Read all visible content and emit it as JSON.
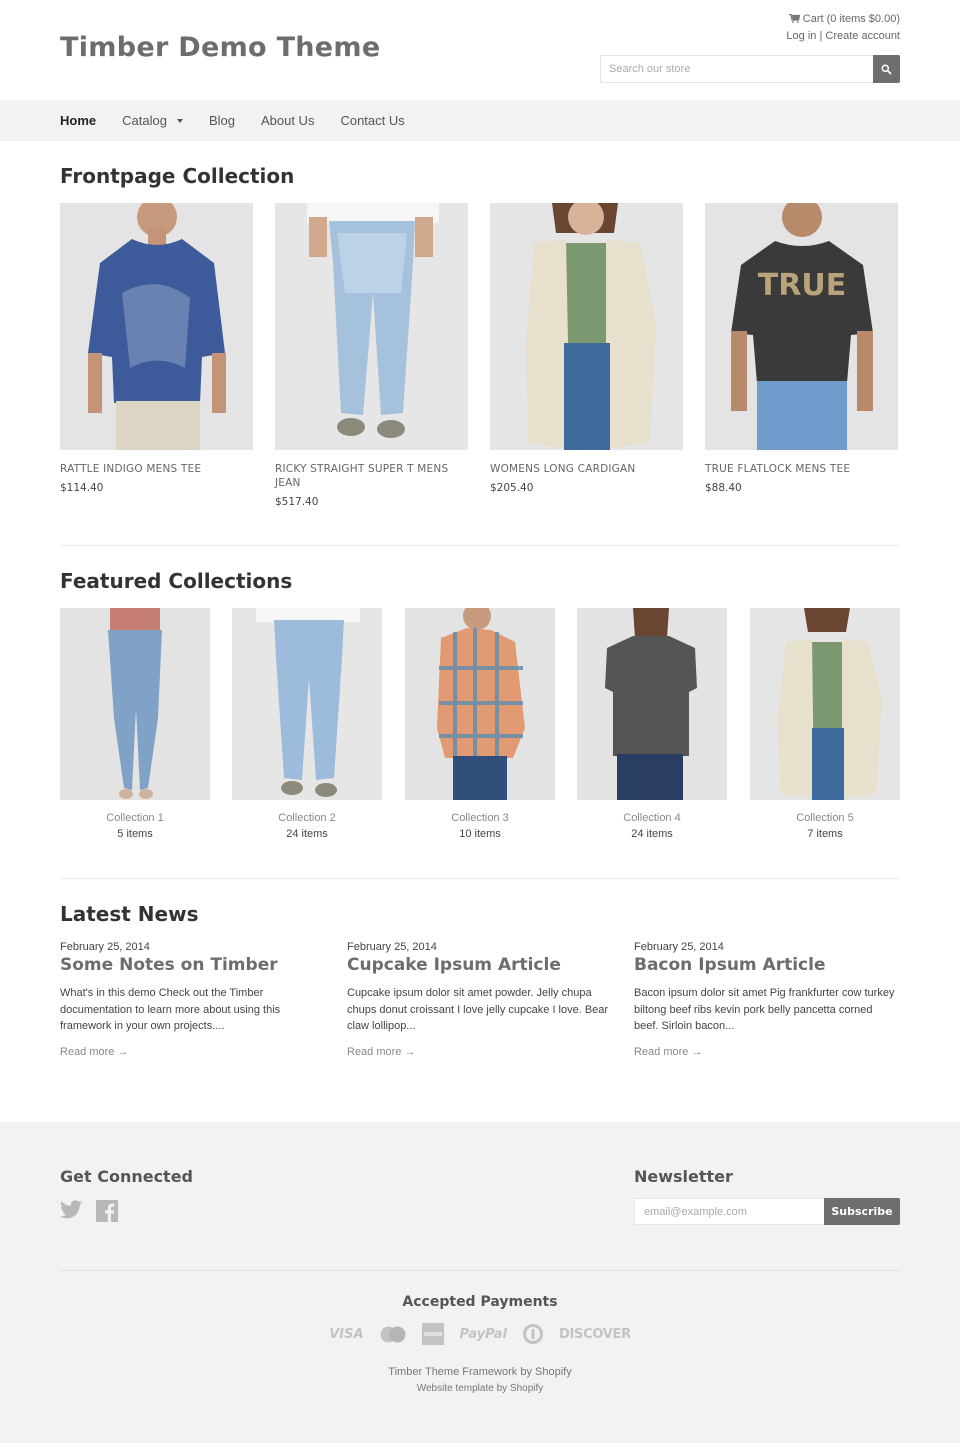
{
  "header": {
    "site_title": "Timber Demo Theme",
    "cart_label": "Cart (0 items $0.00)",
    "login_label": "Log in",
    "separator": "|",
    "create_account_label": "Create account",
    "search_placeholder": "Search our store",
    "search_value": ""
  },
  "nav": {
    "items": [
      {
        "label": "Home",
        "active": true
      },
      {
        "label": "Catalog",
        "has_dropdown": true
      },
      {
        "label": "Blog"
      },
      {
        "label": "About Us"
      },
      {
        "label": "Contact Us"
      }
    ]
  },
  "frontpage": {
    "title": "Frontpage Collection",
    "products": [
      {
        "name": "RATTLE INDIGO MENS TEE",
        "price": "$114.40",
        "image": "man-blue-tee"
      },
      {
        "name": "RICKY STRAIGHT SUPER T MENS JEAN",
        "price": "$517.40",
        "image": "light-wash-jeans"
      },
      {
        "name": "WOMENS LONG CARDIGAN",
        "price": "$205.40",
        "image": "woman-cream-cardigan"
      },
      {
        "name": "TRUE FLATLOCK MENS TEE",
        "price": "$88.40",
        "image": "man-charcoal-tee"
      }
    ]
  },
  "featured": {
    "title": "Featured Collections",
    "collections": [
      {
        "name": "Collection 1",
        "count": "5 items",
        "image": "womens-skinny-jeans"
      },
      {
        "name": "Collection 2",
        "count": "24 items",
        "image": "mens-distressed-jeans"
      },
      {
        "name": "Collection 3",
        "count": "10 items",
        "image": "plaid-shirt"
      },
      {
        "name": "Collection 4",
        "count": "24 items",
        "image": "womens-grey-tee"
      },
      {
        "name": "Collection 5",
        "count": "7 items",
        "image": "womens-cardigan"
      }
    ]
  },
  "news": {
    "title": "Latest News",
    "articles": [
      {
        "date": "February 25, 2014",
        "title": "Some Notes on Timber",
        "excerpt": "What's in this demo Check out the Timber documentation to learn more about using this framework in your own projects....",
        "read_more": "Read more →"
      },
      {
        "date": "February 25, 2014",
        "title": "Cupcake Ipsum Article",
        "excerpt": "Cupcake ipsum dolor sit amet powder. Jelly chupa chups donut croissant I love jelly cupcake I love. Bear claw lollipop...",
        "read_more": "Read more →"
      },
      {
        "date": "February 25, 2014",
        "title": "Bacon Ipsum Article",
        "excerpt": "Bacon ipsum dolor sit amet Pig frankfurter cow turkey biltong beef ribs kevin pork belly pancetta corned beef. Sirloin bacon...",
        "read_more": "Read more →"
      }
    ]
  },
  "footer": {
    "connected_title": "Get Connected",
    "social": [
      "twitter-icon",
      "facebook-icon"
    ],
    "newsletter_title": "Newsletter",
    "newsletter_placeholder": "email@example.com",
    "newsletter_value": "",
    "subscribe_label": "Subscribe",
    "payments_title": "Accepted Payments",
    "payments": {
      "visa": "VISA",
      "mastercard": "mastercard",
      "amex": "american-express",
      "paypal": "PayPal",
      "diners": "diners-club",
      "discover": "DISCOVER"
    },
    "credit_1": "Timber Theme Framework by Shopify",
    "credit_2": "Website template by Shopify"
  }
}
